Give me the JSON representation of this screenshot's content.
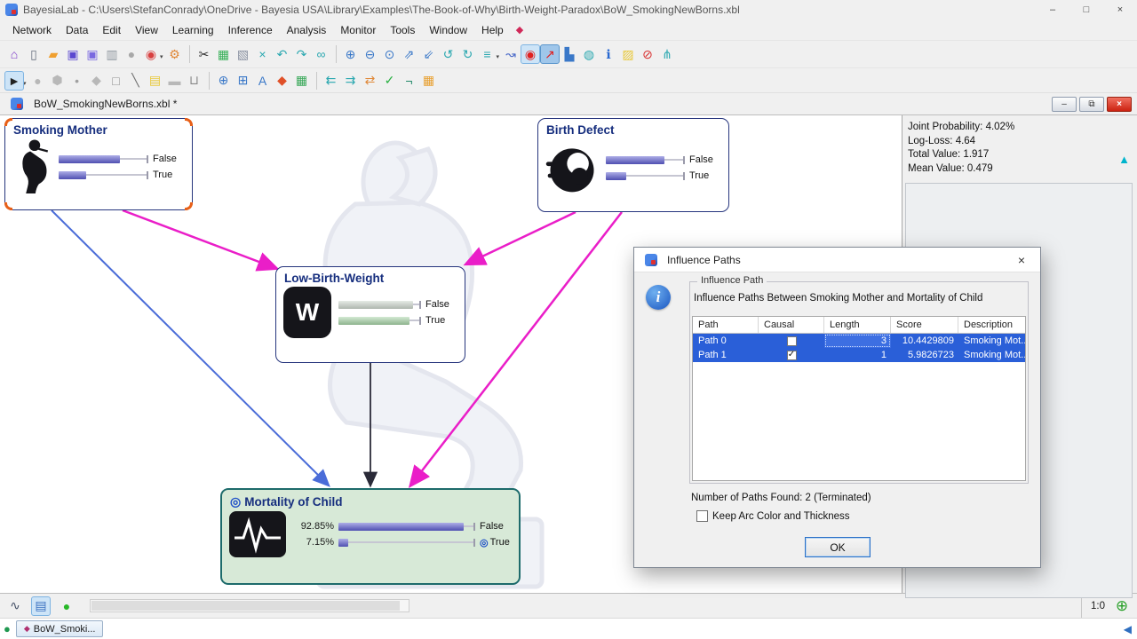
{
  "window": {
    "title": "BayesiaLab - C:\\Users\\StefanConrady\\OneDrive - Bayesia USA\\Library\\Examples\\The-Book-of-Why\\Birth-Weight-Paradox\\BoW_SmokingNewBorns.xbl",
    "minimize": "–",
    "maximize": "□",
    "close": "×"
  },
  "glyphs": {
    "dropdown": "▾",
    "target": "◎",
    "check": "✓",
    "restore": "⧉",
    "minimize": "–",
    "close": "×",
    "triangle_up": "▲",
    "triangle_left": "◀",
    "diamond": "◆",
    "dot": "●"
  },
  "menu": {
    "items": [
      "Network",
      "Data",
      "Edit",
      "View",
      "Learning",
      "Inference",
      "Analysis",
      "Monitor",
      "Tools",
      "Window",
      "Help"
    ]
  },
  "toolbar_main": {
    "items": [
      {
        "name": "home-icon",
        "glyph": "⌂"
      },
      {
        "name": "new-document-icon",
        "glyph": "▯"
      },
      {
        "name": "open-folder-icon",
        "glyph": "▰"
      },
      {
        "name": "save-icon",
        "glyph": "▣"
      },
      {
        "name": "save-as-icon",
        "glyph": "▣"
      },
      {
        "name": "print-icon",
        "glyph": "▥"
      },
      {
        "name": "record-icon",
        "glyph": "●"
      },
      {
        "name": "network-search-icon",
        "glyph": "◉"
      },
      {
        "name": "settings-gear-icon",
        "glyph": "⚙"
      },
      {
        "name": "cut-icon",
        "glyph": "✂"
      },
      {
        "name": "copy-icon",
        "glyph": "▦"
      },
      {
        "name": "paste-icon",
        "glyph": "▧"
      },
      {
        "name": "delete-icon",
        "glyph": "×"
      },
      {
        "name": "undo-icon",
        "glyph": "↶"
      },
      {
        "name": "redo-icon",
        "glyph": "↷"
      },
      {
        "name": "find-icon",
        "glyph": "∞"
      },
      {
        "name": "zoom-in-icon",
        "glyph": "⊕"
      },
      {
        "name": "zoom-out-icon",
        "glyph": "⊖"
      },
      {
        "name": "zoom-reset-icon",
        "glyph": "⊙"
      },
      {
        "name": "expand-graph-icon",
        "glyph": "⇗"
      },
      {
        "name": "contract-graph-icon",
        "glyph": "⇙"
      },
      {
        "name": "rotate-left-icon",
        "glyph": "↺"
      },
      {
        "name": "rotate-right-icon",
        "glyph": "↻"
      },
      {
        "name": "console-icon",
        "glyph": "≡"
      },
      {
        "name": "target-jump-icon",
        "glyph": "↝"
      },
      {
        "name": "stop-inference-icon",
        "glyph": "◉"
      },
      {
        "name": "influence-arrow-icon",
        "glyph": "↗"
      },
      {
        "name": "chart-icon",
        "glyph": "▙"
      },
      {
        "name": "comment-icon",
        "glyph": "◍"
      },
      {
        "name": "info-icon",
        "glyph": "ℹ"
      },
      {
        "name": "highlight-icon",
        "glyph": "▨"
      },
      {
        "name": "forbid-icon",
        "glyph": "⊘"
      },
      {
        "name": "path-analysis-icon",
        "glyph": "⋔"
      }
    ]
  },
  "toolbar_edit": {
    "items": [
      {
        "name": "select-tool-icon",
        "glyph": "►"
      },
      {
        "name": "ellipse-tool-icon",
        "glyph": "●"
      },
      {
        "name": "hexagon-tool-icon",
        "glyph": "⬢"
      },
      {
        "name": "point-tool-icon",
        "glyph": "•"
      },
      {
        "name": "diamond-tool-icon",
        "glyph": "◆"
      },
      {
        "name": "rectangle-tool-icon",
        "glyph": "□"
      },
      {
        "name": "line-tool-icon",
        "glyph": "╲"
      },
      {
        "name": "note-tool-icon",
        "glyph": "▤"
      },
      {
        "name": "capsule-tool-icon",
        "glyph": "▬"
      },
      {
        "name": "delete-tool-icon",
        "glyph": "⊔"
      },
      {
        "name": "zoom-in-tool-icon",
        "glyph": "⊕"
      },
      {
        "name": "zoom-page-tool-icon",
        "glyph": "⊞"
      },
      {
        "name": "zoom-text-tool-icon",
        "glyph": "A"
      },
      {
        "name": "arc-comment-icon",
        "glyph": "◆"
      },
      {
        "name": "monitor-tool-icon",
        "glyph": "▦"
      },
      {
        "name": "arc-backward-icon",
        "glyph": "⇇"
      },
      {
        "name": "arc-forward-icon",
        "glyph": "⇉"
      },
      {
        "name": "swap-arcs-icon",
        "glyph": "⇄"
      },
      {
        "name": "validate-icon",
        "glyph": "✓"
      },
      {
        "name": "negate-icon",
        "glyph": "¬"
      },
      {
        "name": "contingency-icon",
        "glyph": "▦"
      }
    ]
  },
  "document": {
    "tab_title": "BoW_SmokingNewBorns.xbl *"
  },
  "stats_panel": {
    "joint": "Joint Probability: 4.02%",
    "logloss": "Log-Loss: 4.64",
    "total": "Total Value: 1.917",
    "mean": "Mean Value: 0.479"
  },
  "graph": {
    "nodes": [
      {
        "id": "smoking_mother",
        "title": "Smoking Mother",
        "states": [
          {
            "label": "False",
            "bar": "70%",
            "color": "#5c5cd0"
          },
          {
            "label": "True",
            "bar": "31%",
            "color": "#5c5cd0"
          }
        ]
      },
      {
        "id": "birth_defect",
        "title": "Birth Defect",
        "states": [
          {
            "label": "False",
            "bar": "76%",
            "color": "#5c5cd0"
          },
          {
            "label": "True",
            "bar": "27%",
            "color": "#5c5cd0"
          }
        ]
      },
      {
        "id": "low_birth_weight",
        "title": "Low-Birth-Weight",
        "icon_glyph": "W",
        "states": [
          {
            "label": "False",
            "bar": "92%",
            "color": "#ccd6cc"
          },
          {
            "label": "True",
            "bar": "88%",
            "color": "#a6d2a6"
          }
        ]
      },
      {
        "id": "mortality_of_child",
        "title": "Mortality of Child",
        "target": true,
        "states": [
          {
            "label": "False",
            "pct": "92.85%",
            "bar": "92.85%",
            "color": "#5c5cd0"
          },
          {
            "label": "True",
            "pct": "7.15%",
            "bar": "7.15%",
            "color": "#5c5cd0"
          }
        ]
      }
    ],
    "arcs": [
      {
        "from": "Smoking Mother",
        "to": "Low-Birth-Weight",
        "color": "#ea1ec8"
      },
      {
        "from": "Smoking Mother",
        "to": "Mortality of Child",
        "color": "#4a6cd8"
      },
      {
        "from": "Birth Defect",
        "to": "Low-Birth-Weight",
        "color": "#ea1ec8"
      },
      {
        "from": "Birth Defect",
        "to": "Mortality of Child",
        "color": "#ea1ec8"
      },
      {
        "from": "Low-Birth-Weight",
        "to": "Mortality of Child",
        "color": "#2a2a38"
      }
    ]
  },
  "dialog": {
    "title": "Influence Paths",
    "close": "×",
    "group_label": "Influence Path",
    "description": "Influence Paths Between Smoking Mother and Mortality of Child",
    "table": {
      "columns": [
        "Path",
        "Causal",
        "Length",
        "Score",
        "Description"
      ],
      "rows": [
        {
          "path": "Path 0",
          "causal": false,
          "length": "3",
          "score": "10.4429809",
          "description": "Smoking Mot..."
        },
        {
          "path": "Path 1",
          "causal": true,
          "length": "1",
          "score": "5.9826723",
          "description": "Smoking Mot..."
        }
      ]
    },
    "paths_found": "Number of Paths Found: 2 (Terminated)",
    "keep_arc_label": "Keep Arc Color and Thickness",
    "ok_label": "OK"
  },
  "statusbar": {
    "zoom": "1:0"
  },
  "taskbar": {
    "tab_label": "BoW_Smoki..."
  },
  "colors": {
    "selection_blue": "#2a5fd8",
    "arc_direct": "#4a6cd8",
    "arc_path": "#ea1ec8",
    "arc_plain": "#2a2a38",
    "node_border": "#26357d",
    "target_fill": "#d7e9d7",
    "target_border": "#1d6b6b",
    "monitor_bar": "#5c5cd0",
    "accent_teal": "#00b4cc"
  }
}
